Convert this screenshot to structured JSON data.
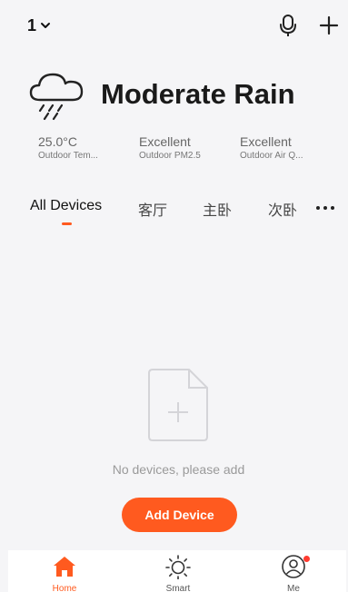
{
  "header": {
    "home_name": "1"
  },
  "weather": {
    "condition": "Moderate Rain",
    "stats": [
      {
        "value": "25.0°C",
        "label": "Outdoor Tem..."
      },
      {
        "value": "Excellent",
        "label": "Outdoor PM2.5"
      },
      {
        "value": "Excellent",
        "label": "Outdoor Air Q..."
      }
    ]
  },
  "tabs": [
    {
      "label": "All Devices",
      "active": true
    },
    {
      "label": "客厅",
      "active": false
    },
    {
      "label": "主卧",
      "active": false
    },
    {
      "label": "次卧",
      "active": false
    }
  ],
  "empty_state": {
    "message": "No devices, please add",
    "button_label": "Add Device"
  },
  "bottom_nav": [
    {
      "label": "Home",
      "icon": "home-icon",
      "active": true
    },
    {
      "label": "Smart",
      "icon": "sun-icon",
      "active": false
    },
    {
      "label": "Me",
      "icon": "profile-icon",
      "active": false,
      "badge": true
    }
  ],
  "colors": {
    "accent": "#ff5a1f",
    "background": "#f5f5f7",
    "badge": "#ff3b30"
  }
}
